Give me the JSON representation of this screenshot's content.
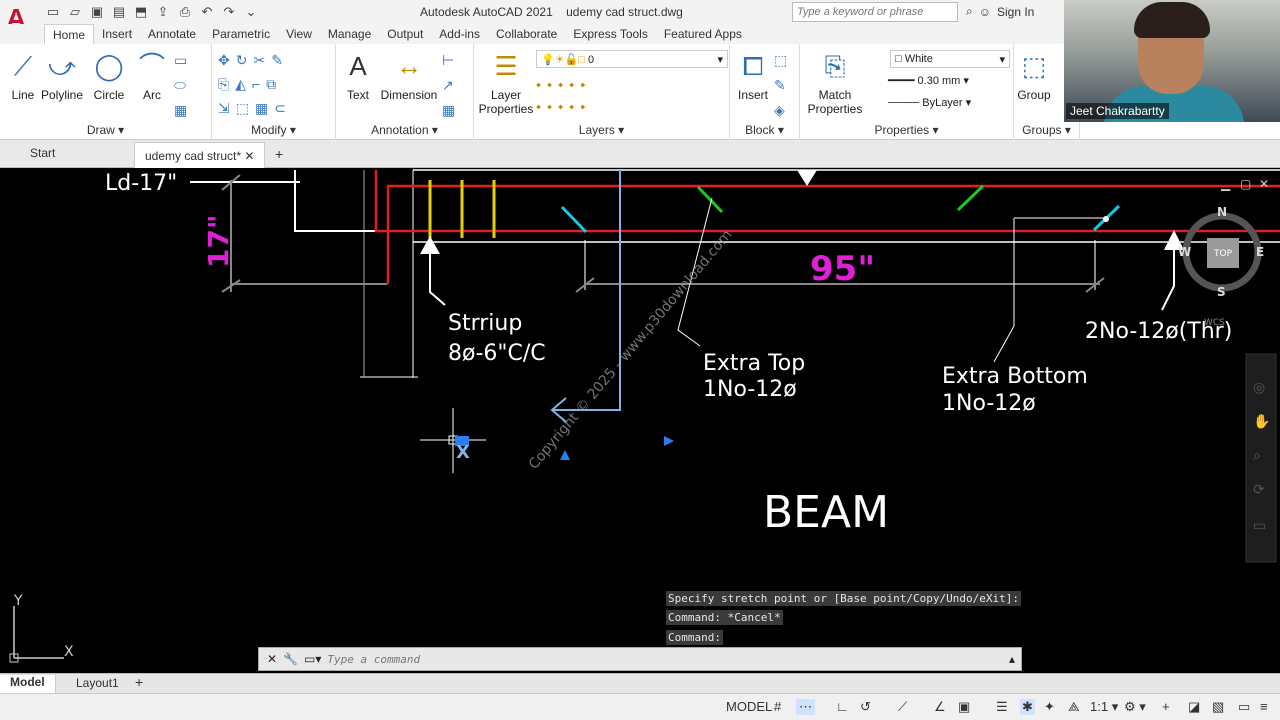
{
  "app": {
    "title": "Autodesk AutoCAD 2021",
    "document": "udemy cad struct.dwg",
    "search_placeholder": "Type a keyword or phrase",
    "sign_in": "Sign In"
  },
  "ribbon_tabs": [
    "Home",
    "Insert",
    "Annotate",
    "Parametric",
    "View",
    "Manage",
    "Output",
    "Add-ins",
    "Collaborate",
    "Express Tools",
    "Featured Apps"
  ],
  "draw_panel": {
    "title": "Draw",
    "tools": [
      "Line",
      "Polyline",
      "Circle",
      "Arc"
    ]
  },
  "modify_panel": {
    "title": "Modify"
  },
  "annotation_panel": {
    "title": "Annotation",
    "tools": [
      "Text",
      "Dimension"
    ]
  },
  "layers_panel": {
    "title": "Layers",
    "layer_properties": "Layer Properties",
    "current_layer": "0"
  },
  "block_panel": {
    "title": "Block",
    "insert": "Insert"
  },
  "properties_panel": {
    "title": "Properties",
    "match": "Match Properties",
    "color": "White",
    "lineweight": "0.30 mm",
    "linetype": "ByLayer"
  },
  "groups_panel": {
    "title": "Groups",
    "group": "Group"
  },
  "webcam": {
    "name": "Jeet Chakrabartty"
  },
  "doc_tabs": {
    "start": "Start",
    "current": "udemy cad struct*"
  },
  "drawing": {
    "ld": "Ld-17\"",
    "dim_height": "17\"",
    "dim_length": "95\"",
    "stirrup_line1": "Strriup",
    "stirrup_line2": "8ø-6\"C/C",
    "extra_top_line1": "Extra Top",
    "extra_top_line2": "1No-12ø",
    "extra_bottom_line1": "Extra Bottom",
    "extra_bottom_line2": "1No-12ø",
    "thr": "2No-12ø(Thr)",
    "beam": "BEAM",
    "watermark": "Copyright © 2025 - www.p30download.com"
  },
  "viewcube": {
    "n": "N",
    "s": "S",
    "e": "E",
    "w": "W",
    "top": "TOP",
    "wcs": "WCS"
  },
  "ucs": {
    "y": "Y",
    "x": "X"
  },
  "command": {
    "history": [
      "Specify stretch point or [Base point/Copy/Undo/eXit]:",
      "Command: *Cancel*",
      "Command:"
    ],
    "placeholder": "Type a command"
  },
  "layout_tabs": [
    "Model",
    "Layout1"
  ],
  "status": {
    "model": "MODEL",
    "scale": "1:1"
  }
}
